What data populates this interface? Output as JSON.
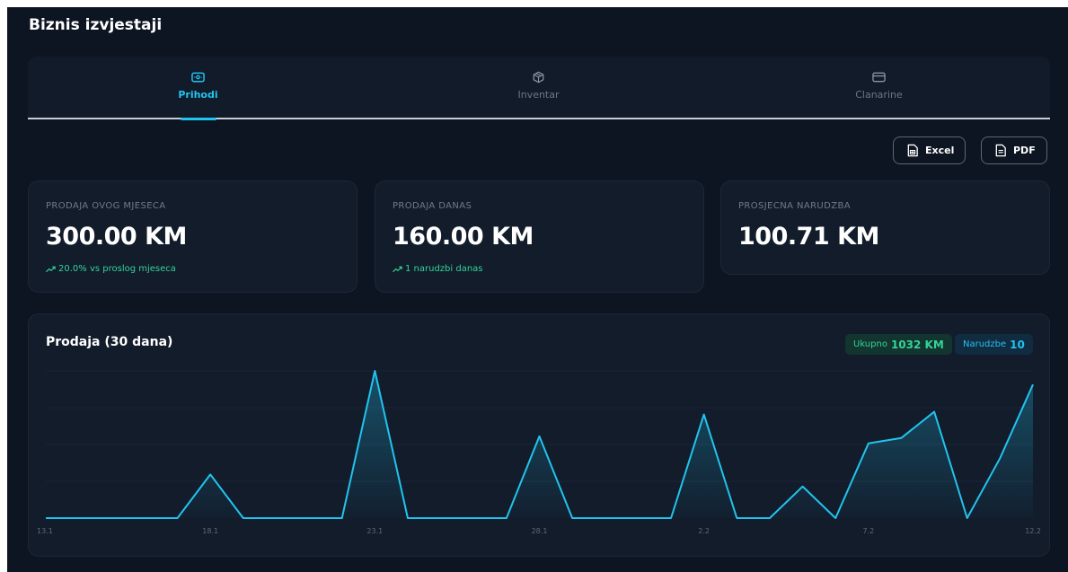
{
  "page": {
    "title": "Biznis izvjestaji"
  },
  "tabs": [
    {
      "label": "Prihodi",
      "icon": "banknote-icon",
      "active": true
    },
    {
      "label": "Inventar",
      "icon": "package-icon",
      "active": false
    },
    {
      "label": "Clanarine",
      "icon": "credit-card-icon",
      "active": false
    }
  ],
  "export": {
    "excel_label": "Excel",
    "pdf_label": "PDF"
  },
  "stats": [
    {
      "label": "PRODAJA OVOG MJESECA",
      "value": "300.00 KM",
      "trend": "20.0% vs proslog mjeseca"
    },
    {
      "label": "PRODAJA DANAS",
      "value": "160.00 KM",
      "trend": "1 narudzbi danas"
    },
    {
      "label": "PROSJECNA NARUDZBA",
      "value": "100.71 KM"
    }
  ],
  "chart_panel": {
    "title": "Prodaja (30 dana)",
    "total_label": "Ukupno",
    "total_value": "1032 KM",
    "orders_label": "Narudzbe",
    "orders_value": "10"
  },
  "colors": {
    "accent": "#22c3ee",
    "positive": "#34d399",
    "background": "#0d1522",
    "card": "#121c2b"
  },
  "chart_data": {
    "type": "area",
    "x": [
      "13.1",
      "14.1",
      "15.1",
      "16.1",
      "17.1",
      "18.1",
      "19.1",
      "20.1",
      "21.1",
      "22.1",
      "23.1",
      "24.1",
      "25.1",
      "26.1",
      "27.1",
      "28.1",
      "29.1",
      "30.1",
      "31.1",
      "1.2",
      "2.2",
      "3.2",
      "4.2",
      "5.2",
      "6.2",
      "7.2",
      "8.2",
      "9.2",
      "10.2",
      "11.2",
      "12.2"
    ],
    "x_tick_labels": [
      "13.1",
      "18.1",
      "23.1",
      "28.1",
      "2.2",
      "7.2",
      "12.2"
    ],
    "values": [
      0,
      0,
      0,
      0,
      0,
      80,
      0,
      0,
      0,
      0,
      270,
      0,
      0,
      0,
      0,
      150,
      0,
      0,
      0,
      0,
      190,
      0,
      0,
      58,
      0,
      137,
      147,
      195,
      0,
      110,
      245
    ],
    "ylim": [
      0,
      270
    ],
    "grid": true,
    "title": "Prodaja (30 dana)"
  }
}
